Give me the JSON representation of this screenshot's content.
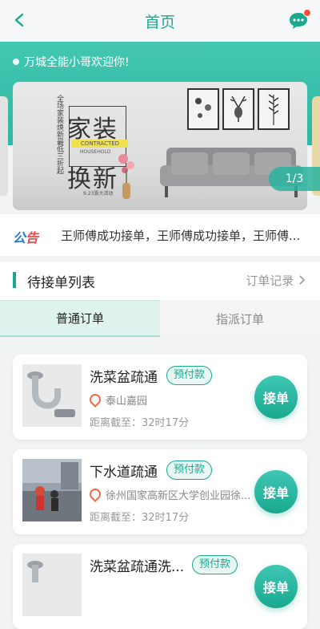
{
  "header": {
    "title": "首页"
  },
  "welcome": {
    "text": "万城全能小哥欢迎你!"
  },
  "banner": {
    "headline_top": "家装",
    "headline_bottom": "换新",
    "vertical_text": "全场家装焕新最低三折起",
    "ribbon": "CONTRACTED",
    "household": "HOUSEHOLD",
    "footnote": "9.23震大活动",
    "pager": "1/3"
  },
  "notice": {
    "logo_part1": "公",
    "logo_part2": "告",
    "text": "王师傅成功接单，王师傅成功接单，王师傅..."
  },
  "section": {
    "title": "待接单列表",
    "record_link": "订单记录"
  },
  "tabs": [
    {
      "label": "普通订单",
      "active": true
    },
    {
      "label": "指派订单",
      "active": false
    }
  ],
  "orders": [
    {
      "title": "洗菜盆疏通",
      "tag": "预付款",
      "location": "泰山嘉园",
      "distance": "距离截至：32时17分",
      "button": "接单"
    },
    {
      "title": "下水道疏通",
      "tag": "预付款",
      "location": "徐州国家高新区大学创业园徐...",
      "distance": "距离截至：32时17分",
      "button": "接单"
    },
    {
      "title": "洗菜盆疏通洗...",
      "tag": "预付款",
      "location": "",
      "distance": "",
      "button": "接单"
    }
  ],
  "colors": {
    "accent": "#1aa88f",
    "banner_teal": "#43c7b3",
    "notification_dot": "#ff4d3a"
  }
}
